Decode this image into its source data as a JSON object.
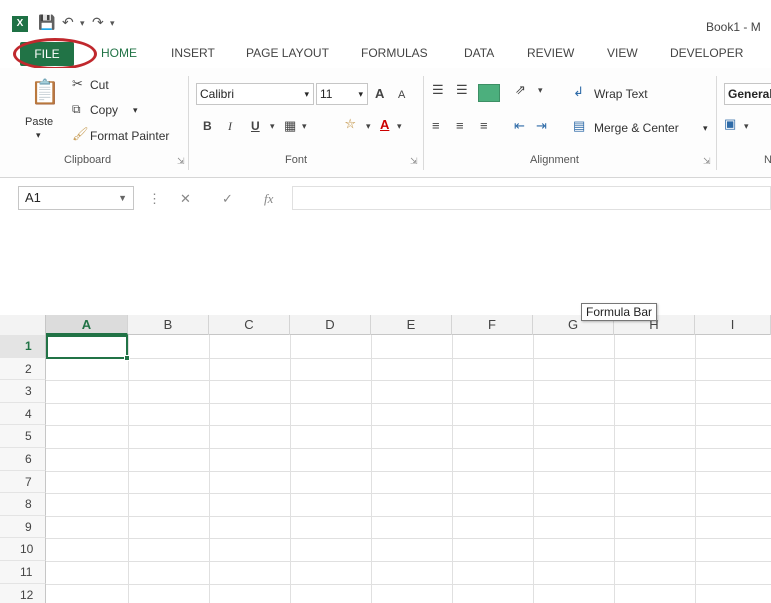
{
  "window": {
    "title": "Book1 - M"
  },
  "tabs": [
    "FILE",
    "HOME",
    "INSERT",
    "PAGE LAYOUT",
    "FORMULAS",
    "DATA",
    "REVIEW",
    "VIEW",
    "DEVELOPER"
  ],
  "ribbon": {
    "clipboard": {
      "paste": "Paste",
      "cut": "Cut",
      "copy": "Copy",
      "format_painter": "Format Painter",
      "group_label": "Clipboard"
    },
    "font": {
      "name": "Calibri",
      "size": "11",
      "bold": "B",
      "italic": "I",
      "underline": "U",
      "grow": "A",
      "shrink": "A",
      "font_color": "A",
      "group_label": "Font"
    },
    "alignment": {
      "wrap_text": "Wrap Text",
      "merge_center": "Merge & Center",
      "group_label": "Alignment"
    },
    "number": {
      "format": "General",
      "group_label": "N"
    }
  },
  "formula_bar": {
    "name_box": "A1",
    "fx": "fx",
    "tooltip": "Formula Bar"
  },
  "sheet": {
    "columns": [
      "A",
      "B",
      "C",
      "D",
      "E",
      "F",
      "G",
      "H",
      "I"
    ],
    "rows": [
      "1",
      "2",
      "3",
      "4",
      "5",
      "6",
      "7",
      "8",
      "9",
      "10",
      "11",
      "12"
    ],
    "active_cell": "A1"
  },
  "colors": {
    "accent": "#217346",
    "highlight_ring": "#c0282d"
  }
}
